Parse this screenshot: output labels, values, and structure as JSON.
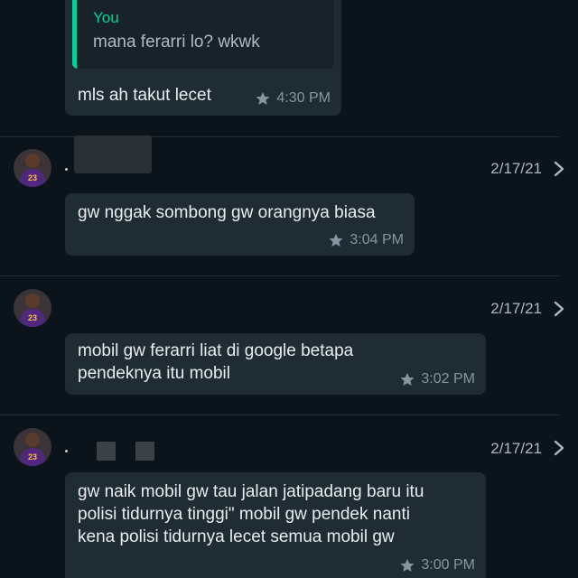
{
  "messages": [
    {
      "quote": {
        "author": "You",
        "text": "mana ferarri lo? wkwk"
      },
      "text": "mls ah takut lecet",
      "time": "4:30 PM"
    },
    {
      "date": "2/17/21",
      "lines": [
        "gw nggak sombong gw orangnya biasa"
      ],
      "time": "3:04 PM"
    },
    {
      "date": "2/17/21",
      "lines": [
        "mobil gw ferarri liat di google betapa",
        "pendeknya itu mobil"
      ],
      "time": "3:02 PM"
    },
    {
      "date": "2/17/21",
      "lines": [
        "gw naik mobil gw tau jalan jatipadang baru itu",
        "polisi tidurnya tinggi\" mobil gw pendek nanti",
        "kena polisi tidurnya lecet semua mobil gw"
      ],
      "time": "3:00 PM"
    }
  ],
  "icons": {
    "star": "star-icon",
    "chevron": "chevron-right-icon",
    "avatar": "avatar-jersey-23"
  },
  "colors": {
    "background": "#0b141a",
    "bubble": "#1f2c34",
    "quote_accent": "#06cf9c",
    "meta_text": "#8696a0"
  }
}
